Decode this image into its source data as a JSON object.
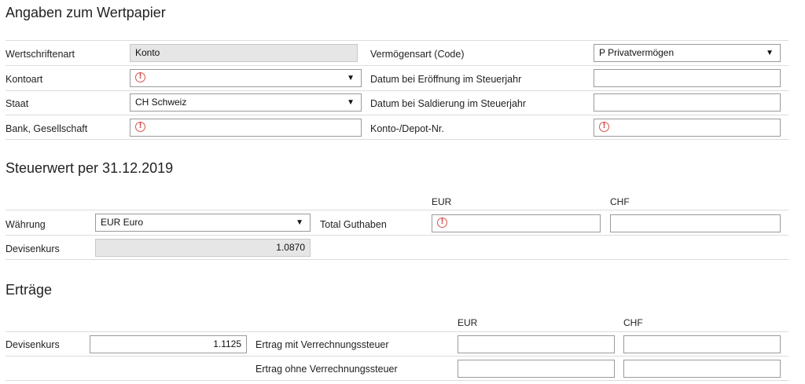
{
  "wertpapier": {
    "title": "Angaben zum Wertpapier",
    "wertschriftenart_label": "Wertschriftenart",
    "wertschriftenart_value": "Konto",
    "kontoart_label": "Kontoart",
    "kontoart_value": "",
    "staat_label": "Staat",
    "staat_value": "CH Schweiz",
    "bank_label": "Bank, Gesellschaft",
    "bank_value": "",
    "vermoegensart_label": "Vermögensart (Code)",
    "vermoegensart_value": "P Privatvermögen",
    "eroeffnung_label": "Datum bei Eröffnung im Steuerjahr",
    "eroeffnung_value": "",
    "saldierung_label": "Datum bei Saldierung im Steuerjahr",
    "saldierung_value": "",
    "depotnr_label": "Konto-/Depot-Nr.",
    "depotnr_value": ""
  },
  "steuerwert": {
    "title": "Steuerwert per 31.12.2019",
    "col_eur": "EUR",
    "col_chf": "CHF",
    "waehrung_label": "Währung",
    "waehrung_value": "EUR Euro",
    "total_label": "Total Guthaben",
    "total_eur_value": "",
    "total_chf_value": "",
    "devisenkurs_label": "Devisenkurs",
    "devisenkurs_value": "1.0870"
  },
  "ertraege": {
    "title": "Erträge",
    "col_eur": "EUR",
    "col_chf": "CHF",
    "devisenkurs_label": "Devisenkurs",
    "devisenkurs_value": "1.1125",
    "mit_vst_label": "Ertrag mit Verrechnungssteuer",
    "ohne_vst_label": "Ertrag ohne Verrechnungssteuer",
    "mit_eur_value": "",
    "mit_chf_value": "",
    "ohne_eur_value": "",
    "ohne_chf_value": ""
  },
  "icons": {
    "warning": "!",
    "dropdown": "▼"
  },
  "colors": {
    "warning": "#d9534f",
    "readonly_bg": "#e6e6e6"
  }
}
